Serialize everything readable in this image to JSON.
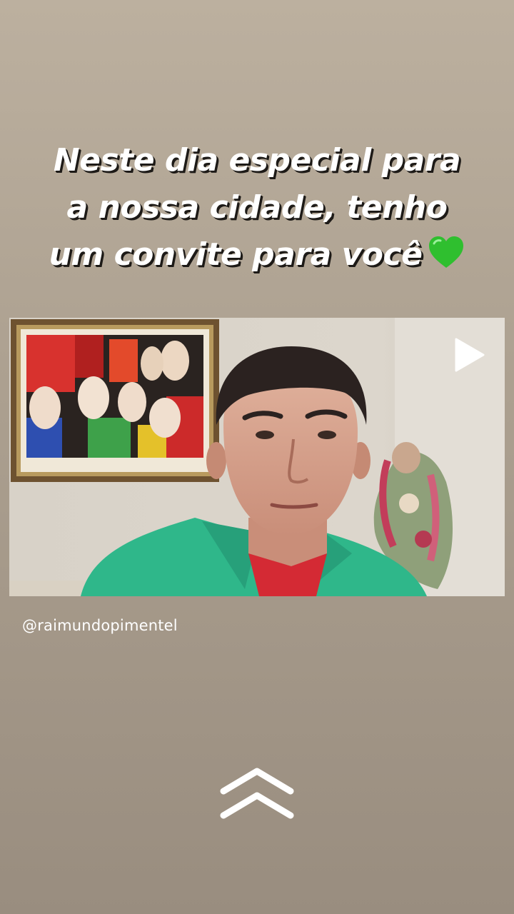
{
  "story": {
    "caption_lines": [
      "Neste dia especial para",
      "a nossa cidade, tenho",
      "um convite para você"
    ],
    "caption_emoji": "green-heart-icon",
    "username": "@raimundopimentel",
    "video": {
      "play_icon": "play-icon"
    },
    "swipe_up_icon": "double-chevron-up-icon"
  },
  "colors": {
    "background_top": "#bcb09f",
    "background_bottom": "#998d7f",
    "caption_text": "#ffffff",
    "caption_shadow": "#1d1a17",
    "heart": "#2fbf2f",
    "shirt": "#2fb78a"
  }
}
